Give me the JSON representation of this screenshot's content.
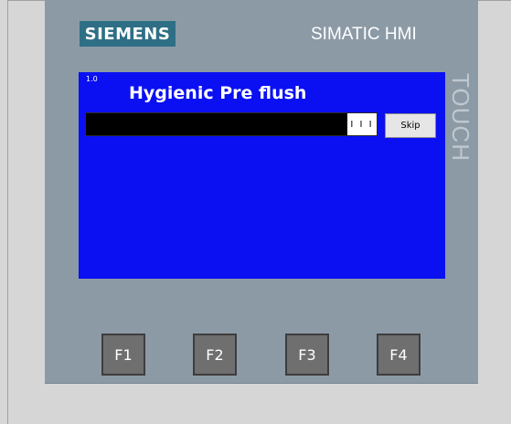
{
  "brand": {
    "logo_text": "SIEMENS",
    "product_text": "SIMATIC HMI",
    "touch_text": "TOUCH"
  },
  "screen": {
    "version": "1.0",
    "title": "Hygienic Pre flush",
    "progress": {
      "fraction": 1.0,
      "marker_text": "I I I"
    },
    "skip_label": "Skip"
  },
  "function_keys": [
    "F1",
    "F2",
    "F3",
    "F4"
  ],
  "colors": {
    "screen_bg": "#0a10f2",
    "bezel": "#8c9aa6",
    "logo_bg": "#2f6f86",
    "key_bg": "#6f6f6f",
    "background": "#d6d6d6"
  }
}
